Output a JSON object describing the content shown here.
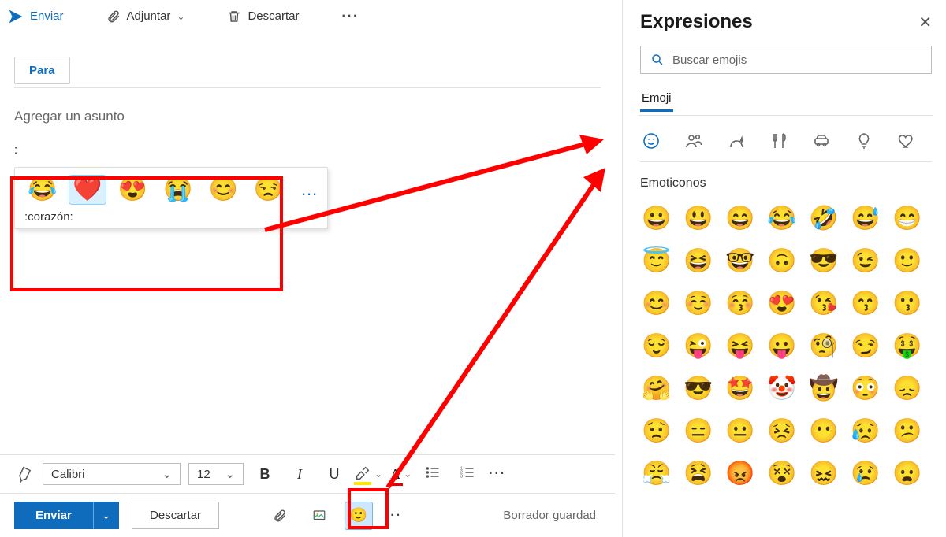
{
  "toolbar": {
    "send": "Enviar",
    "attach": "Adjuntar",
    "discard": "Descartar"
  },
  "compose": {
    "to_button": "Para",
    "subject_placeholder": "Agregar un asunto",
    "body_text": ":"
  },
  "suggest": {
    "emojis": [
      "😂",
      "❤️",
      "😍",
      "😭",
      "😊",
      "😒"
    ],
    "selected_index": 1,
    "label": ":corazón:",
    "more": "…"
  },
  "format": {
    "font": "Calibri",
    "size": "12"
  },
  "bottom": {
    "send": "Enviar",
    "discard": "Descartar",
    "draft_saved": "Borrador guardad"
  },
  "panel": {
    "title": "Expresiones",
    "search_placeholder": "Buscar emojis",
    "tab": "Emoji",
    "section": "Emoticonos",
    "grid": [
      "😀",
      "😃",
      "😄",
      "😂",
      "🤣",
      "😅",
      "😁",
      "😇",
      "😆",
      "🤓",
      "🙃",
      "😎",
      "😉",
      "🙂",
      "😊",
      "☺️",
      "😚",
      "😍",
      "😘",
      "😙",
      "😗",
      "😌",
      "😜",
      "😝",
      "😛",
      "🧐",
      "😏",
      "🤑",
      "🤗",
      "😎",
      "🤩",
      "🤡",
      "🤠",
      "😳",
      "😞",
      "😟",
      "😑",
      "😐",
      "😣",
      "😶",
      "😥",
      "😕",
      "😤",
      "😫",
      "😡",
      "😵",
      "😖",
      "😢",
      "😦"
    ]
  }
}
